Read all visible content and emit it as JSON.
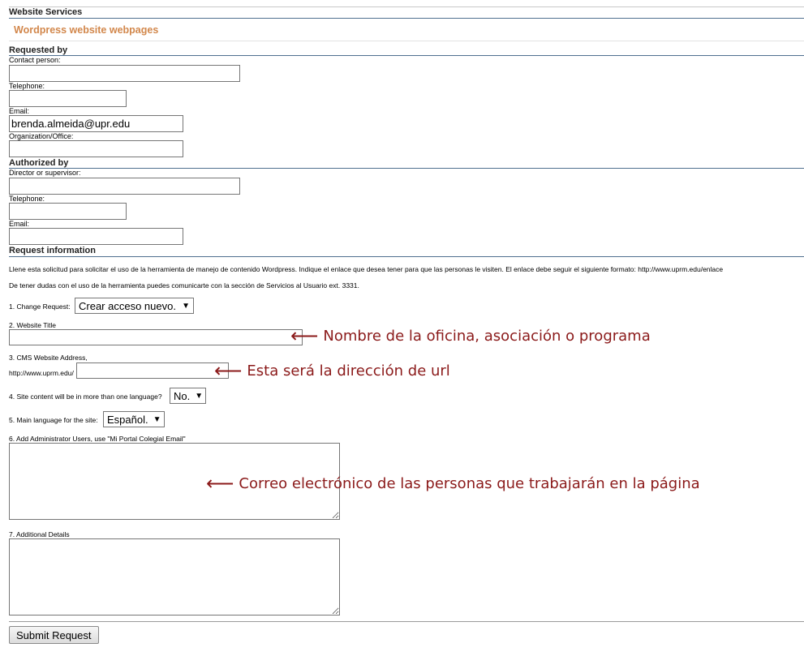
{
  "header": {
    "title": "Website Services",
    "subtitle": "Wordpress website webpages"
  },
  "requested_by": {
    "title": "Requested by",
    "contact_label": "Contact person:",
    "contact_value": "",
    "telephone_label": "Telephone:",
    "telephone_value": "",
    "email_label": "Email:",
    "email_value": "brenda.almeida@upr.edu",
    "org_label": "Organization/Office:",
    "org_value": ""
  },
  "authorized_by": {
    "title": "Authorized by",
    "director_label": "Director or supervisor:",
    "director_value": "",
    "telephone_label": "Telephone:",
    "telephone_value": "",
    "email_label": "Email:",
    "email_value": ""
  },
  "request_info": {
    "title": "Request information",
    "instructions_1": "Llene esta solicitud para solicitar el uso de la herramienta de manejo de contenido Wordpress. Indique el enlace que desea tener para que las personas le visiten. El enlace debe seguir el siguiente formato: http://www.uprm.edu/enlace",
    "instructions_2": "De tener dudas con el uso de la herramienta puedes comunicarte con la sección de Servicios al Usuario ext. 3331.",
    "change_request_label": "1. Change Request:",
    "change_request_value": "Crear acceso nuevo.",
    "website_title_label": "2. Website Title",
    "website_title_value": "",
    "cms_address_label": "3. CMS Website Address,",
    "cms_prefix": "http://www.uprm.edu/",
    "cms_value": "",
    "multilang_label": "4. Site content will be in more than one language?",
    "multilang_value": "No.",
    "main_lang_label": "5. Main language for the site:",
    "main_lang_value": "Español.",
    "admin_users_label": "6. Add Administrator Users, use \"Mi Portal Colegial Email\"",
    "admin_users_value": "",
    "details_label": "7. Additional Details",
    "details_value": ""
  },
  "annotations": {
    "title_hint": "Nombre de la oficina, asociación o programa",
    "url_hint": "Esta será la dirección de url",
    "admin_hint": "Correo electrónico de las personas que trabajarán en la página"
  },
  "submit_label": "Submit Request",
  "icons": {
    "select_arrow": "▼",
    "annotation_arrow": "⟵"
  }
}
